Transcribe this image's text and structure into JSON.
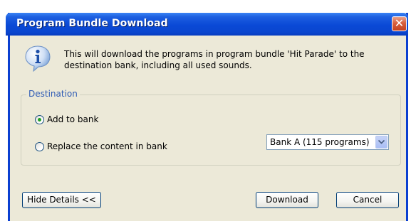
{
  "dialog": {
    "title": "Program Bundle Download",
    "close_glyph": "✕",
    "message": "This will download the programs in program bundle 'Hit Parade' to the destination bank, including all used sounds.",
    "icon": "info-icon"
  },
  "destination": {
    "legend": "Destination",
    "option_add": "Add to bank",
    "option_replace": "Replace the content in bank",
    "selected_option": "Add to bank",
    "bank_select": "Bank A (115 programs)"
  },
  "buttons": {
    "details": "Hide Details <<",
    "download": "Download",
    "cancel": "Cancel"
  },
  "colors": {
    "title_bar": "#0a49d6",
    "dialog_bg": "#ece9d8",
    "legend_text": "#2d5ab4"
  }
}
